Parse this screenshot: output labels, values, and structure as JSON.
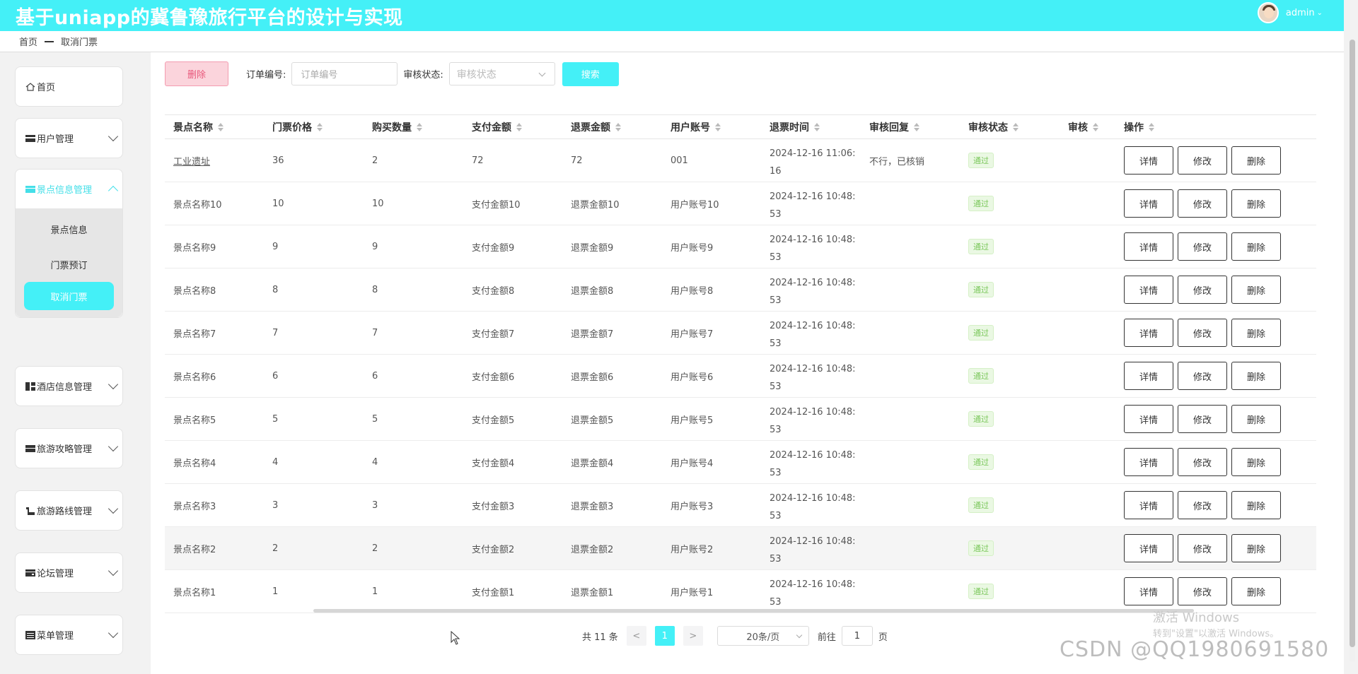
{
  "header": {
    "title": "基于uniapp的冀鲁豫旅行平台的设计与实现",
    "user": "admin"
  },
  "breadcrumb": {
    "home": "首页",
    "current": "取消门票"
  },
  "sidebar": {
    "home": "首页",
    "items": [
      {
        "label": "用户管理"
      },
      {
        "label": "景点信息管理",
        "sub": [
          "景点信息",
          "门票预订",
          "取消门票"
        ]
      },
      {
        "label": "酒店信息管理"
      },
      {
        "label": "旅游攻略管理"
      },
      {
        "label": "旅游路线管理"
      },
      {
        "label": "论坛管理"
      },
      {
        "label": "菜单管理"
      }
    ]
  },
  "toolbar": {
    "delete": "删除",
    "order_label": "订单编号:",
    "order_placeholder": "订单编号",
    "status_label": "审核状态:",
    "status_placeholder": "审核状态",
    "search": "搜索"
  },
  "table": {
    "columns": [
      "景点名称",
      "门票价格",
      "购买数量",
      "支付金额",
      "退票金额",
      "用户账号",
      "退票时间",
      "审核回复",
      "审核状态",
      "审核",
      "操作"
    ],
    "rows": [
      {
        "name": "工业遗址",
        "price": "36",
        "qty": "2",
        "paid": "72",
        "refund": "72",
        "account": "001",
        "time1": "2024-12-16 11:06:",
        "time2": "16",
        "reply": "不行，已核销",
        "status": "通过"
      },
      {
        "name": "景点名称10",
        "price": "10",
        "qty": "10",
        "paid": "支付金额10",
        "refund": "退票金额10",
        "account": "用户账号10",
        "time1": "2024-12-16 10:48:",
        "time2": "53",
        "reply": "",
        "status": "通过"
      },
      {
        "name": "景点名称9",
        "price": "9",
        "qty": "9",
        "paid": "支付金额9",
        "refund": "退票金额9",
        "account": "用户账号9",
        "time1": "2024-12-16 10:48:",
        "time2": "53",
        "reply": "",
        "status": "通过"
      },
      {
        "name": "景点名称8",
        "price": "8",
        "qty": "8",
        "paid": "支付金额8",
        "refund": "退票金额8",
        "account": "用户账号8",
        "time1": "2024-12-16 10:48:",
        "time2": "53",
        "reply": "",
        "status": "通过"
      },
      {
        "name": "景点名称7",
        "price": "7",
        "qty": "7",
        "paid": "支付金额7",
        "refund": "退票金额7",
        "account": "用户账号7",
        "time1": "2024-12-16 10:48:",
        "time2": "53",
        "reply": "",
        "status": "通过"
      },
      {
        "name": "景点名称6",
        "price": "6",
        "qty": "6",
        "paid": "支付金额6",
        "refund": "退票金额6",
        "account": "用户账号6",
        "time1": "2024-12-16 10:48:",
        "time2": "53",
        "reply": "",
        "status": "通过"
      },
      {
        "name": "景点名称5",
        "price": "5",
        "qty": "5",
        "paid": "支付金额5",
        "refund": "退票金额5",
        "account": "用户账号5",
        "time1": "2024-12-16 10:48:",
        "time2": "53",
        "reply": "",
        "status": "通过"
      },
      {
        "name": "景点名称4",
        "price": "4",
        "qty": "4",
        "paid": "支付金额4",
        "refund": "退票金额4",
        "account": "用户账号4",
        "time1": "2024-12-16 10:48:",
        "time2": "53",
        "reply": "",
        "status": "通过"
      },
      {
        "name": "景点名称3",
        "price": "3",
        "qty": "3",
        "paid": "支付金额3",
        "refund": "退票金额3",
        "account": "用户账号3",
        "time1": "2024-12-16 10:48:",
        "time2": "53",
        "reply": "",
        "status": "通过"
      },
      {
        "name": "景点名称2",
        "price": "2",
        "qty": "2",
        "paid": "支付金额2",
        "refund": "退票金额2",
        "account": "用户账号2",
        "time1": "2024-12-16 10:48:",
        "time2": "53",
        "reply": "",
        "status": "通过"
      },
      {
        "name": "景点名称1",
        "price": "1",
        "qty": "1",
        "paid": "支付金额1",
        "refund": "退票金额1",
        "account": "用户账号1",
        "time1": "2024-12-16 10:48:",
        "time2": "53",
        "reply": "",
        "status": "通过"
      }
    ],
    "actions": [
      "详情",
      "修改",
      "删除"
    ]
  },
  "pagination": {
    "total": "共 11 条",
    "prev": "<",
    "current": "1",
    "next": ">",
    "page_size": "20条/页",
    "goto_label": "前往",
    "goto_value": "1",
    "goto_suffix": "页"
  },
  "watermark": {
    "activate_title": "激活 Windows",
    "activate_sub": "转到\"设置\"以激活 Windows。",
    "csdn": "CSDN @QQ1980691580"
  },
  "colors": {
    "accent": "#44f0f7",
    "danger_bg": "#fbd4dc",
    "success": "#7ac75a"
  }
}
